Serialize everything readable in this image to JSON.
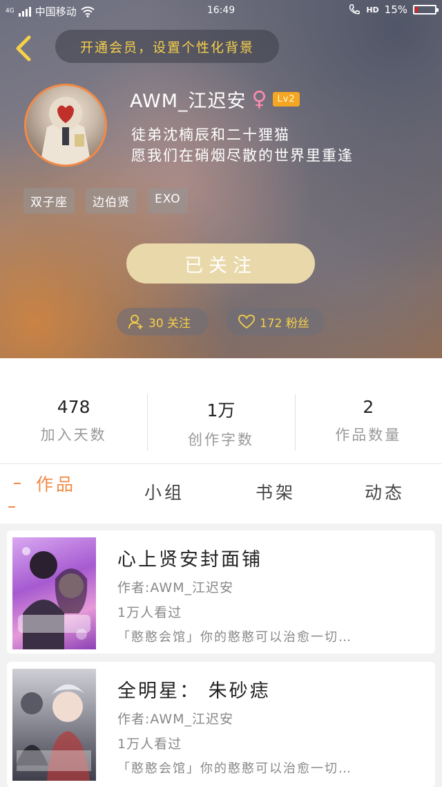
{
  "status_bar": {
    "network": "4G",
    "carrier": "中国移动",
    "time": "16:49",
    "hd": "HD",
    "battery": "15%",
    "battery_level": 0.15
  },
  "header": {
    "promo_text": "开通会员，设置个性化背景"
  },
  "profile": {
    "username": "AWM_江迟安",
    "gender_symbol": "♀",
    "level": "Lv2",
    "bio_line1": "徒弟沈楠辰和二十狸猫",
    "bio_line2": "愿我们在硝烟尽散的世界里重逢",
    "tags": [
      "双子座",
      "边伯贤",
      "EXO"
    ],
    "follow_button": "已关注",
    "following_count": "30 关注",
    "fans_count": "172 粉丝"
  },
  "stats": [
    {
      "value": "478",
      "label": "加入天数"
    },
    {
      "value": "1万",
      "label": "创作字数"
    },
    {
      "value": "2",
      "label": "作品数量"
    }
  ],
  "tabs": [
    "作品",
    "小组",
    "书架",
    "动态"
  ],
  "works": [
    {
      "title": "心上贤安封面铺",
      "author": "作者:AWM_江迟安",
      "views": "1万人看过",
      "desc": "「憨憨会馆」你的憨憨可以治愈一切…"
    },
    {
      "title": "全明星： 朱砂痣",
      "author": "作者:AWM_江迟安",
      "views": "1万人看过",
      "desc": "「憨憨会馆」你的憨憨可以治愈一切…"
    }
  ],
  "colors": {
    "accent_orange": "#f38a45",
    "accent_yellow": "#f7d04a",
    "follow_bg": "#e9d8a9",
    "level_badge": "#f5a623"
  },
  "icons": {
    "back": "chevron-left-icon",
    "following": "add-user-icon",
    "fans": "heart-icon"
  }
}
